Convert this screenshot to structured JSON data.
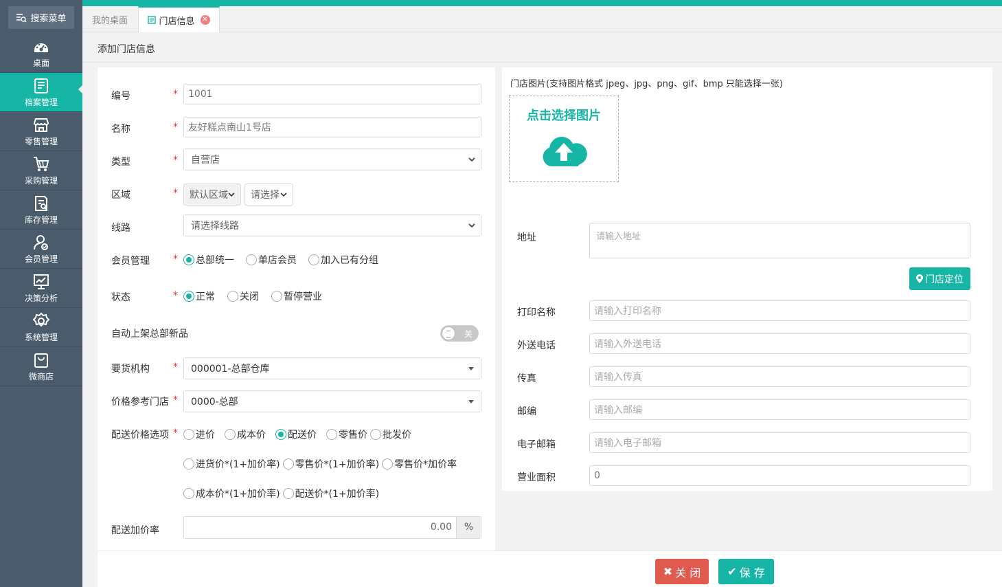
{
  "sidebar": {
    "search_label": "搜索菜单",
    "items": [
      {
        "label": "桌面",
        "icon": "dashboard-icon"
      },
      {
        "label": "档案管理",
        "icon": "archive-icon",
        "active": true
      },
      {
        "label": "零售管理",
        "icon": "store-icon"
      },
      {
        "label": "采购管理",
        "icon": "cart-icon"
      },
      {
        "label": "库存管理",
        "icon": "inventory-icon"
      },
      {
        "label": "会员管理",
        "icon": "member-icon"
      },
      {
        "label": "决策分析",
        "icon": "chart-icon"
      },
      {
        "label": "系统管理",
        "icon": "gear-icon"
      },
      {
        "label": "微商店",
        "icon": "bag-icon"
      }
    ]
  },
  "tabs": {
    "home": "我的桌面",
    "active": "门店信息"
  },
  "page_title": "添加门店信息",
  "form_left": {
    "code": {
      "label": "编号",
      "value": "1001"
    },
    "name": {
      "label": "名称",
      "value": "友好糕点南山1号店"
    },
    "type": {
      "label": "类型",
      "value": "自营店"
    },
    "region": {
      "label": "区域",
      "value1": "默认区域",
      "value2": "请选择"
    },
    "route": {
      "label": "线路",
      "value": "请选择线路"
    },
    "member": {
      "label": "会员管理",
      "options": [
        "总部统一",
        "单店会员",
        "加入已有分组"
      ],
      "selected": "总部统一"
    },
    "status": {
      "label": "状态",
      "options": [
        "正常",
        "关闭",
        "暂停营业"
      ],
      "selected": "正常"
    },
    "auto_list": {
      "label": "自动上架总部新品",
      "toggle_text": "关"
    },
    "supply_org": {
      "label": "要货机构",
      "value": "000001-总部仓库"
    },
    "price_ref": {
      "label": "价格参考门店",
      "value": "0000-总部"
    },
    "price_options": {
      "label": "配送价格选项",
      "row1": [
        "进价",
        "成本价",
        "配送价",
        "零售价",
        "批发价"
      ],
      "row2": [
        "进货价*(1+加价率)",
        "零售价*(1+加价率)",
        "零售价*加价率"
      ],
      "row3": [
        "成本价*(1+加价率)",
        "配送价*(1+加价率)"
      ],
      "selected": "配送价"
    },
    "markup": {
      "label": "配送加价率",
      "value": "0.00",
      "unit": "%"
    }
  },
  "form_right": {
    "image_label": "门店图片(支持图片格式 jpeg、jpg、png、gif、bmp 只能选择一张)",
    "upload_text": "点击选择图片",
    "address": {
      "label": "地址",
      "placeholder": "请输入地址"
    },
    "locate_button": "门店定位",
    "print_name": {
      "label": "打印名称",
      "placeholder": "请输入打印名称"
    },
    "delivery_phone": {
      "label": "外送电话",
      "placeholder": "请输入外送电话"
    },
    "fax": {
      "label": "传真",
      "placeholder": "请输入传真"
    },
    "postcode": {
      "label": "邮编",
      "placeholder": "请输入邮编"
    },
    "email": {
      "label": "电子邮箱",
      "placeholder": "请输入电子邮箱"
    },
    "area": {
      "label": "营业面积",
      "value": "0"
    }
  },
  "footer": {
    "close_label": "关 闭",
    "save_label": "保 存"
  },
  "colors": {
    "accent": "#16b5a6",
    "sidebar": "#4a5b6c",
    "danger": "#e05a4e"
  }
}
